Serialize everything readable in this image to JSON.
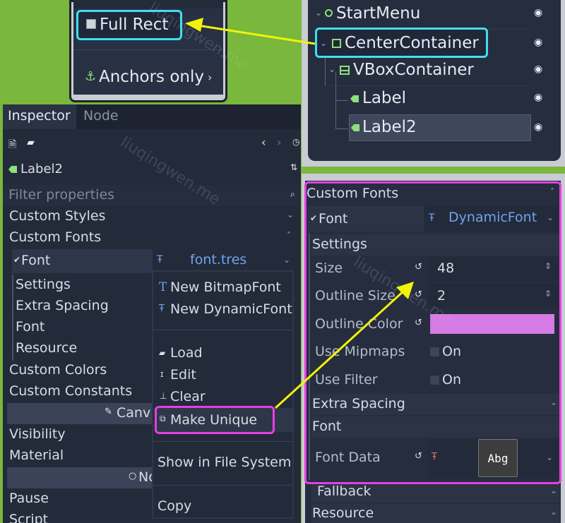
{
  "popup": {
    "full_rect": "Full Rect",
    "anchors_only": "Anchors only"
  },
  "inspector": {
    "tabs": [
      "Inspector",
      "Node"
    ],
    "node_name": "Label2",
    "filter_placeholder": "Filter properties",
    "sections": {
      "custom_styles": "Custom Styles",
      "custom_fonts": "Custom Fonts",
      "font": "Font",
      "font_value": "font.tres",
      "settings": "Settings",
      "extra_spacing": "Extra Spacing",
      "font2": "Font",
      "resource": "Resource",
      "custom_colors": "Custom Colors",
      "custom_constants": "Custom Constants",
      "canvas": "Canv",
      "visibility": "Visibility",
      "material": "Material",
      "node": "No",
      "pause": "Pause",
      "script": "Script"
    }
  },
  "context_menu": {
    "items": [
      "New BitmapFont",
      "New DynamicFont",
      "Load",
      "Edit",
      "Clear",
      "Make Unique",
      "Show in File System",
      "Copy"
    ]
  },
  "scene_tree": {
    "nodes": [
      "StartMenu",
      "CenterContainer",
      "VBoxContainer",
      "Label",
      "Label2"
    ]
  },
  "font_panel": {
    "custom_fonts": "Custom Fonts",
    "font": "Font",
    "font_value": "DynamicFont",
    "settings": "Settings",
    "size_label": "Size",
    "size_value": "48",
    "outline_size_label": "Outline Size",
    "outline_size_value": "2",
    "outline_color_label": "Outline Color",
    "outline_color": "#d67ae4",
    "use_mipmaps_label": "Use Mipmaps",
    "use_mipmaps_value": "On",
    "use_filter_label": "Use Filter",
    "use_filter_value": "On",
    "extra_spacing": "Extra Spacing",
    "font_section": "Font",
    "font_data_label": "Font Data",
    "font_data_preview": "Abg",
    "fallback": "Fallback",
    "resource": "Resource"
  },
  "watermark": "liuqingwen.me",
  "colors": {
    "highlight_cyan": "#3ee0f0",
    "highlight_magenta": "#e53fe6",
    "arrow_yellow": "#f2f20a",
    "frame_green": "#79b73d"
  }
}
